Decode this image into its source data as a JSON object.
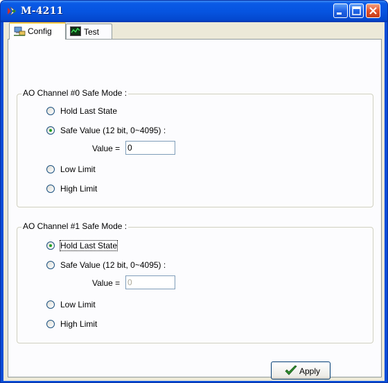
{
  "window": {
    "title": "M-4211"
  },
  "tabs": [
    {
      "label": "Config",
      "icon": "network-config-icon",
      "active": true
    },
    {
      "label": "Test",
      "icon": "chart-monitor-icon",
      "active": false
    }
  ],
  "groups": [
    {
      "title": "AO Channel #0 Safe Mode :",
      "options": [
        "Hold Last State",
        "Safe Value (12 bit, 0~4095) :",
        "Low Limit",
        "High Limit"
      ],
      "selected": "Safe Value (12 bit, 0~4095) :",
      "value_label": "Value =",
      "value": "0",
      "value_enabled": true
    },
    {
      "title": "AO Channel #1 Safe Mode :",
      "options": [
        "Hold Last State",
        "Safe Value (12 bit, 0~4095) :",
        "Low Limit",
        "High Limit"
      ],
      "selected": "Hold Last State",
      "value_label": "Value =",
      "value": "0",
      "value_enabled": false
    }
  ],
  "apply_button": {
    "label": "Apply",
    "icon": "checkmark-icon"
  },
  "colors": {
    "titlebar": "#0a5ae6",
    "face": "#ece9d8",
    "radio_dot": "#21a121"
  }
}
